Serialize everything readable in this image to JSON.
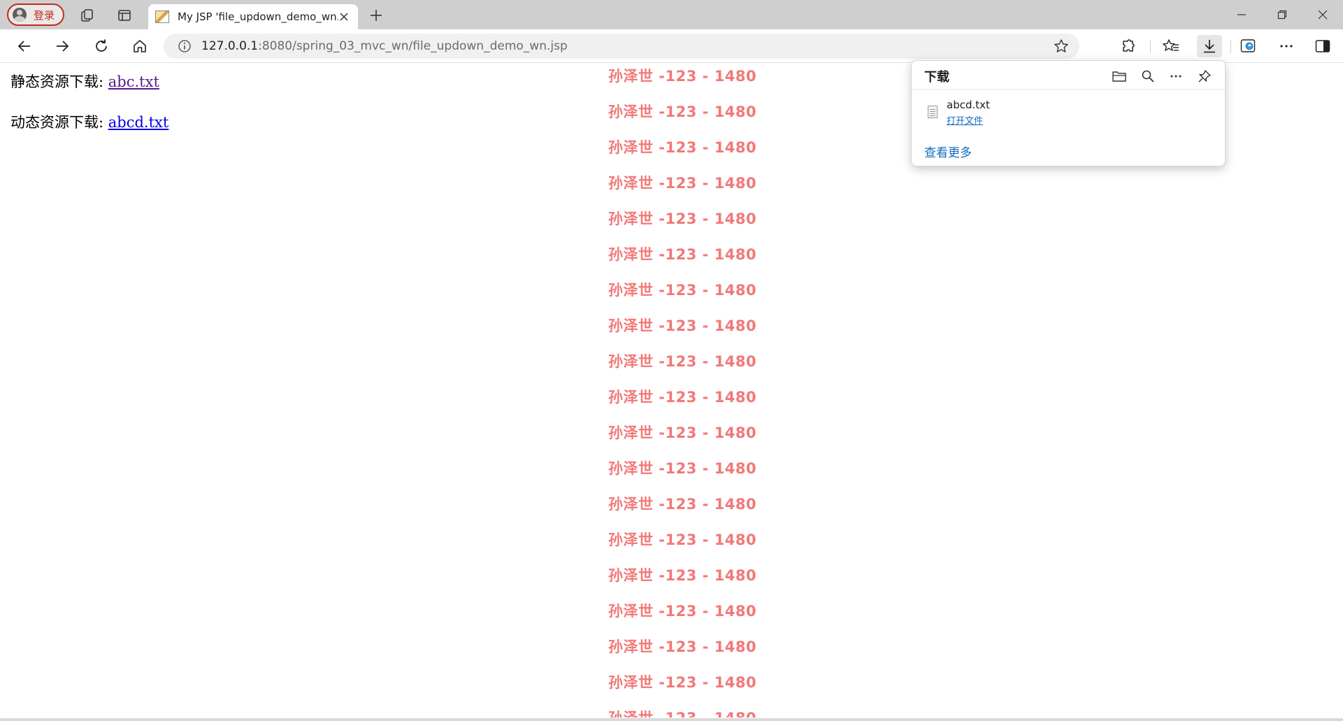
{
  "browser": {
    "profile_label": "登录",
    "tab_title": "My JSP 'file_updown_demo_wn.jsp",
    "address": {
      "host": "127.0.0.1",
      "path": ":8080/spring_03_mvc_wn/file_updown_demo_wn.jsp"
    }
  },
  "page": {
    "static_download_label": "静态资源下载:",
    "static_download_link": "abc.txt",
    "dynamic_download_label": "动态资源下载:",
    "dynamic_download_link": "abcd.txt",
    "watermark_text": "孙泽世 -123 - 1480",
    "watermark_color": "#f27878"
  },
  "downloads_flyout": {
    "title": "下载",
    "file_name": "abcd.txt",
    "open_file_label": "打开文件",
    "see_more_label": "查看更多"
  },
  "icons": [
    "profile-avatar-icon",
    "workspaces-icon",
    "tab-actions-icon",
    "page-favicon-icon",
    "close-icon",
    "plus-icon",
    "minimize-icon",
    "restore-icon",
    "window-close-icon",
    "back-icon",
    "forward-icon",
    "refresh-icon",
    "home-icon",
    "info-icon",
    "star-icon",
    "extensions-icon",
    "favorites-icon",
    "download-icon",
    "edge-icon",
    "more-icon",
    "sidebar-icon",
    "folder-icon",
    "search-icon",
    "pin-icon",
    "file-icon"
  ],
  "colors": {
    "accent": "#0f6cbd",
    "profile_border": "#c42b1c",
    "titlebar": "#cfcfcf"
  }
}
